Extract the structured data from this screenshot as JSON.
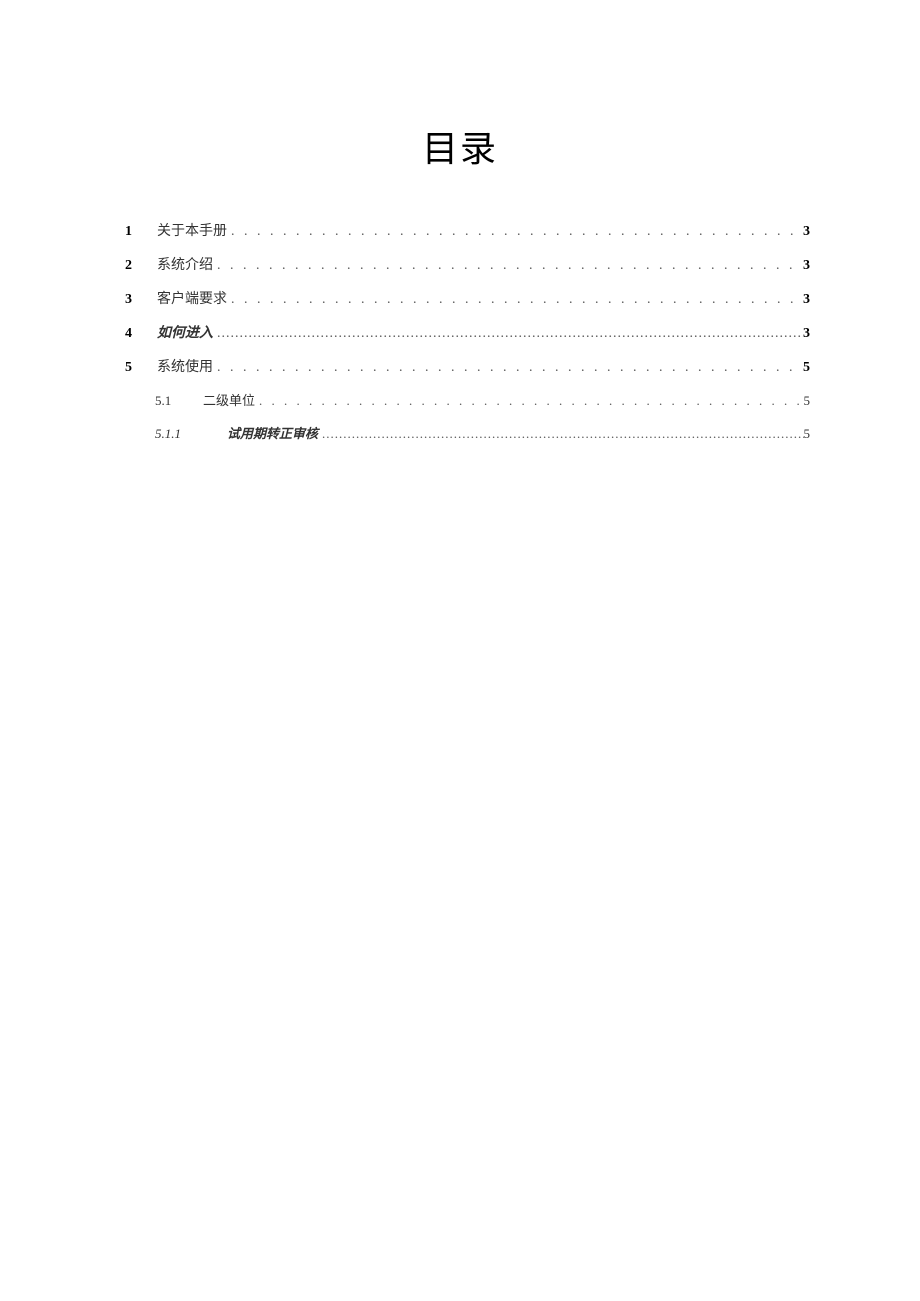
{
  "title": "目录",
  "toc": {
    "entries": [
      {
        "level": 1,
        "num": "1",
        "text": "关于本手册",
        "page": "3",
        "italic": false
      },
      {
        "level": 1,
        "num": "2",
        "text": "系统介绍",
        "page": "3",
        "italic": false
      },
      {
        "level": 1,
        "num": "3",
        "text": "客户端要求",
        "page": "3",
        "italic": false
      },
      {
        "level": 1,
        "num": "4",
        "text": "如何进入",
        "page": "3",
        "italic": true
      },
      {
        "level": 1,
        "num": "5",
        "text": "系统使用",
        "page": "5",
        "italic": false
      },
      {
        "level": 2,
        "num": "5.1",
        "text": "二级单位",
        "page": "5",
        "italic": false
      },
      {
        "level": 3,
        "num": "5.1.1",
        "text": "试用期转正审核",
        "page": "5",
        "italic": true
      }
    ]
  }
}
